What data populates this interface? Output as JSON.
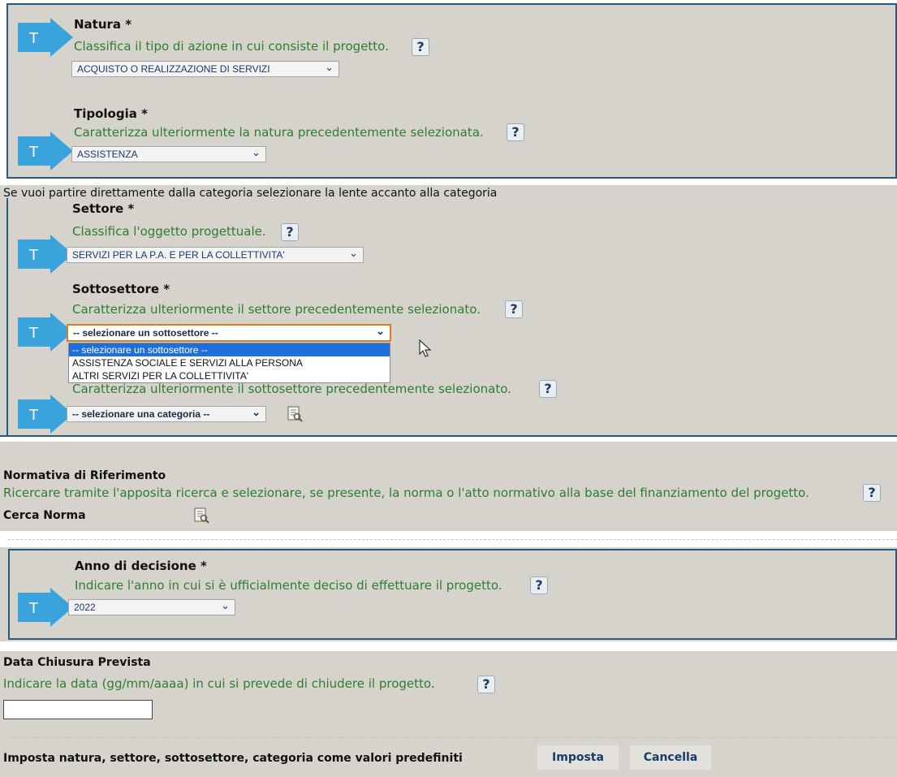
{
  "natura": {
    "label": "Natura *",
    "desc": "Classifica il tipo di azione in cui consiste il progetto.",
    "value": "ACQUISTO O REALIZZAZIONE DI SERVIZI"
  },
  "tipologia": {
    "label": "Tipologia *",
    "desc": "Caratterizza ulteriormente la natura precedentemente selezionata.",
    "value": "ASSISTENZA"
  },
  "hint_lente": "Se vuoi partire direttamente dalla categoria selezionare la lente accanto alla categoria",
  "settore": {
    "label": "Settore *",
    "desc": "Classifica l'oggetto progettuale.",
    "value": "SERVIZI PER LA P.A. E PER LA COLLETTIVITA'"
  },
  "sottosettore": {
    "label": "Sottosettore *",
    "desc": "Caratterizza ulteriormente il settore precedentemente selezionato.",
    "value": "-- selezionare un sottosettore --",
    "options": [
      "-- selezionare un sottosettore --",
      "ASSISTENZA SOCIALE E SERVIZI ALLA PERSONA",
      "ALTRI SERVIZI PER LA COLLETTIVITA'"
    ]
  },
  "categoria": {
    "desc": "Caratterizza ulteriormente il sottosettore precedentemente selezionato.",
    "value": "-- selezionare una categoria --"
  },
  "normativa": {
    "label": "Normativa di Riferimento",
    "desc": "Ricercare tramite l'apposita ricerca e selezionare, se presente, la norma o l'atto normativo alla base del finanziamento del progetto.",
    "cerca_label": "Cerca Norma"
  },
  "anno": {
    "label": "Anno di decisione *",
    "desc": "Indicare l'anno in cui si è ufficialmente deciso di effettuare il progetto.",
    "value": "2022"
  },
  "data_chiusura": {
    "label": "Data Chiusura Prevista",
    "desc": "Indicare la data (gg/mm/aaaa) in cui si prevede di chiudere il progetto.",
    "value": ""
  },
  "footer": {
    "label": "Imposta natura, settore, sottosettore, categoria come valori predefiniti",
    "imposta": "Imposta",
    "cancella": "Cancella"
  },
  "help_glyph": "?",
  "t_glyph": "T",
  "colors": {
    "panel": "#d6d3cc",
    "border": "#2a5a7a",
    "desc_green": "#2f7d2f",
    "arrow_blue": "#3aa3dc",
    "focus_orange": "#e07a1e",
    "highlight": "#1e6fd9"
  }
}
